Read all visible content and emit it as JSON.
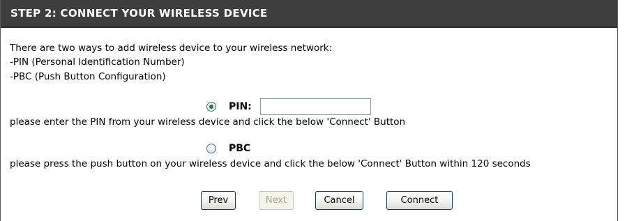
{
  "header": {
    "title": "STEP 2: CONNECT YOUR WIRELESS DEVICE"
  },
  "intro": {
    "line1": "There are two ways to add wireless device to your wireless network:",
    "line2": "-PIN (Personal Identification Number)",
    "line3": "-PBC (Push Button Configuration)"
  },
  "pin_option": {
    "label": "PIN:",
    "selected": true,
    "input_value": "",
    "instruction": "please enter the PIN from your wireless device and click the below 'Connect' Button"
  },
  "pbc_option": {
    "label": "PBC",
    "selected": false,
    "instruction": "please press the push button on your wireless device and click the below 'Connect' Button within 120 seconds"
  },
  "buttons": {
    "prev": "Prev",
    "next": "Next",
    "cancel": "Cancel",
    "connect": "Connect"
  },
  "colors": {
    "header_bg": "#3e3e3e",
    "header_text": "#ffffff",
    "radio_selected": "#2b7a2b"
  }
}
